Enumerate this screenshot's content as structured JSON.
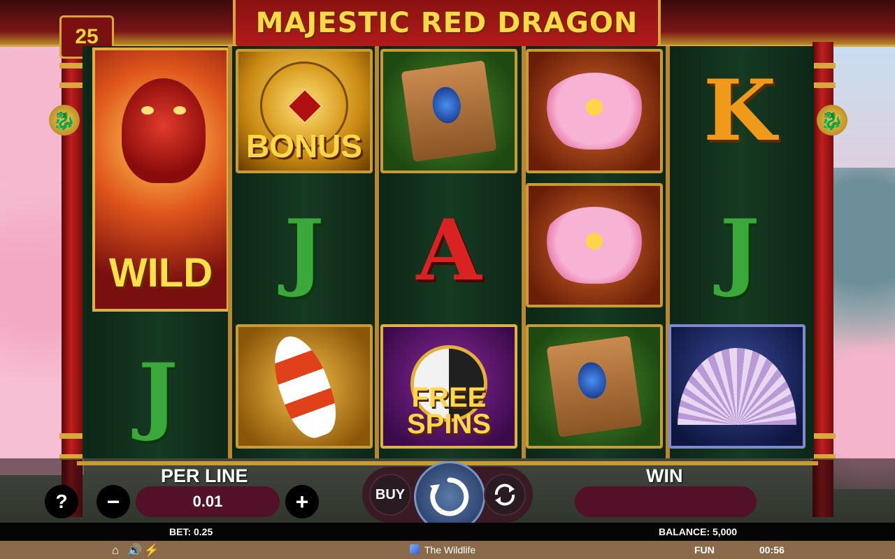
{
  "game": {
    "title": "MAJESTIC RED DRAGON",
    "lines": "25"
  },
  "reels": {
    "reel1": [
      "WILD",
      "J"
    ],
    "reel2": [
      "BONUS",
      "J",
      "koi"
    ],
    "reel3": [
      "scroll",
      "A",
      "FREE SPINS"
    ],
    "reel4": [
      "lotus",
      "lotus",
      "scroll"
    ],
    "reel5": [
      "K",
      "J",
      "fan"
    ],
    "wild_label": "WILD",
    "bonus_label": "BONUS",
    "freespins_label_1": "FREE",
    "freespins_label_2": "SPINS",
    "letter_j": "J",
    "letter_a": "A",
    "letter_k": "K"
  },
  "controls": {
    "per_line_label": "PER LINE",
    "per_line_value": "0.01",
    "minus": "−",
    "plus": "+",
    "help": "?",
    "buy_label": "BUY",
    "win_label": "WIN",
    "win_value": ""
  },
  "status": {
    "bet": "BET: 0.25",
    "balance": "BALANCE: 5,000"
  },
  "footer": {
    "brand": "The Wildlife",
    "mode": "FUN",
    "time": "00:56",
    "icons": [
      "home-icon",
      "sound-icon",
      "turbo-icon"
    ]
  }
}
